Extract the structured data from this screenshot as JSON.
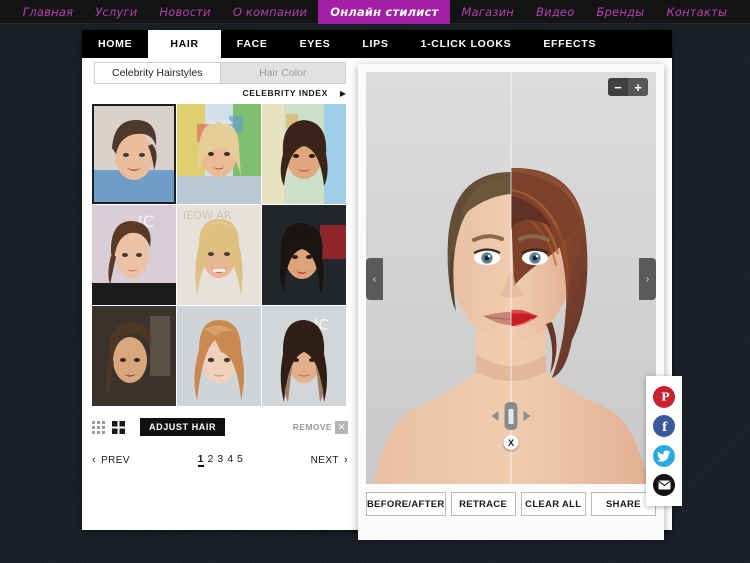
{
  "site_nav": {
    "items": [
      {
        "label": "Главная",
        "active": false
      },
      {
        "label": "Услуги",
        "active": false
      },
      {
        "label": "Новости",
        "active": false
      },
      {
        "label": "О компании",
        "active": false
      },
      {
        "label": "Онлайн стилист",
        "active": true
      },
      {
        "label": "Магазин",
        "active": false
      },
      {
        "label": "Видео",
        "active": false
      },
      {
        "label": "Бренды",
        "active": false
      },
      {
        "label": "Контакты",
        "active": false
      }
    ],
    "accent_color": "#a41fa4",
    "link_color": "#b43fb4",
    "background_color": "#141414"
  },
  "tab_bar": {
    "tabs": [
      {
        "label": "HOME",
        "active": false
      },
      {
        "label": "HAIR",
        "active": true
      },
      {
        "label": "FACE",
        "active": false
      },
      {
        "label": "EYES",
        "active": false
      },
      {
        "label": "LIPS",
        "active": false
      },
      {
        "label": "1-CLICK LOOKS",
        "active": false
      },
      {
        "label": "EFFECTS",
        "active": false
      }
    ]
  },
  "left_panel": {
    "subtabs": [
      {
        "label": "Celebrity Hairstyles",
        "active": true
      },
      {
        "label": "Hair Color",
        "active": false
      }
    ],
    "celebrity_index": {
      "label": "CELEBRITY INDEX",
      "arrow": "▶"
    },
    "thumbnails": [
      {
        "name": "celebrity-thumb-1",
        "selected": true
      },
      {
        "name": "celebrity-thumb-2",
        "selected": false
      },
      {
        "name": "celebrity-thumb-3",
        "selected": false
      },
      {
        "name": "celebrity-thumb-4",
        "selected": false
      },
      {
        "name": "celebrity-thumb-5",
        "selected": false
      },
      {
        "name": "celebrity-thumb-6",
        "selected": false
      },
      {
        "name": "celebrity-thumb-7",
        "selected": false
      },
      {
        "name": "celebrity-thumb-8",
        "selected": false
      },
      {
        "name": "celebrity-thumb-9",
        "selected": false
      }
    ],
    "controls": {
      "view_small_grid_icon": "grid-3x3-icon",
      "view_large_grid_icon": "grid-2x2-icon",
      "adjust_hair_label": "ADJUST HAIR",
      "remove_label": "REMOVE",
      "remove_icon": "close-x-icon"
    },
    "pagination": {
      "prev_label": "PREV",
      "prev_icon": "chevron-left-icon",
      "next_label": "NEXT",
      "next_icon": "chevron-right-icon",
      "pages": [
        "1",
        "2",
        "3",
        "4",
        "5"
      ],
      "current_page": "1"
    }
  },
  "photo_panel": {
    "zoom": {
      "out_label": "−",
      "in_label": "+"
    },
    "arrow_left": "‹",
    "arrow_right": "›",
    "split_close_label": "X",
    "social": [
      {
        "name": "pinterest-icon",
        "glyph": "P",
        "color": "#c8232c"
      },
      {
        "name": "facebook-icon",
        "glyph": "f",
        "color": "#3b5998"
      },
      {
        "name": "twitter-icon",
        "glyph": "✉",
        "color": "#29a9e0"
      },
      {
        "name": "email-icon",
        "glyph": "✉",
        "color": "#121212"
      }
    ],
    "action_buttons": [
      {
        "label": "BEFORE/AFTER"
      },
      {
        "label": "RETRACE"
      },
      {
        "label": "CLEAR ALL"
      },
      {
        "label": "SHARE"
      }
    ]
  }
}
